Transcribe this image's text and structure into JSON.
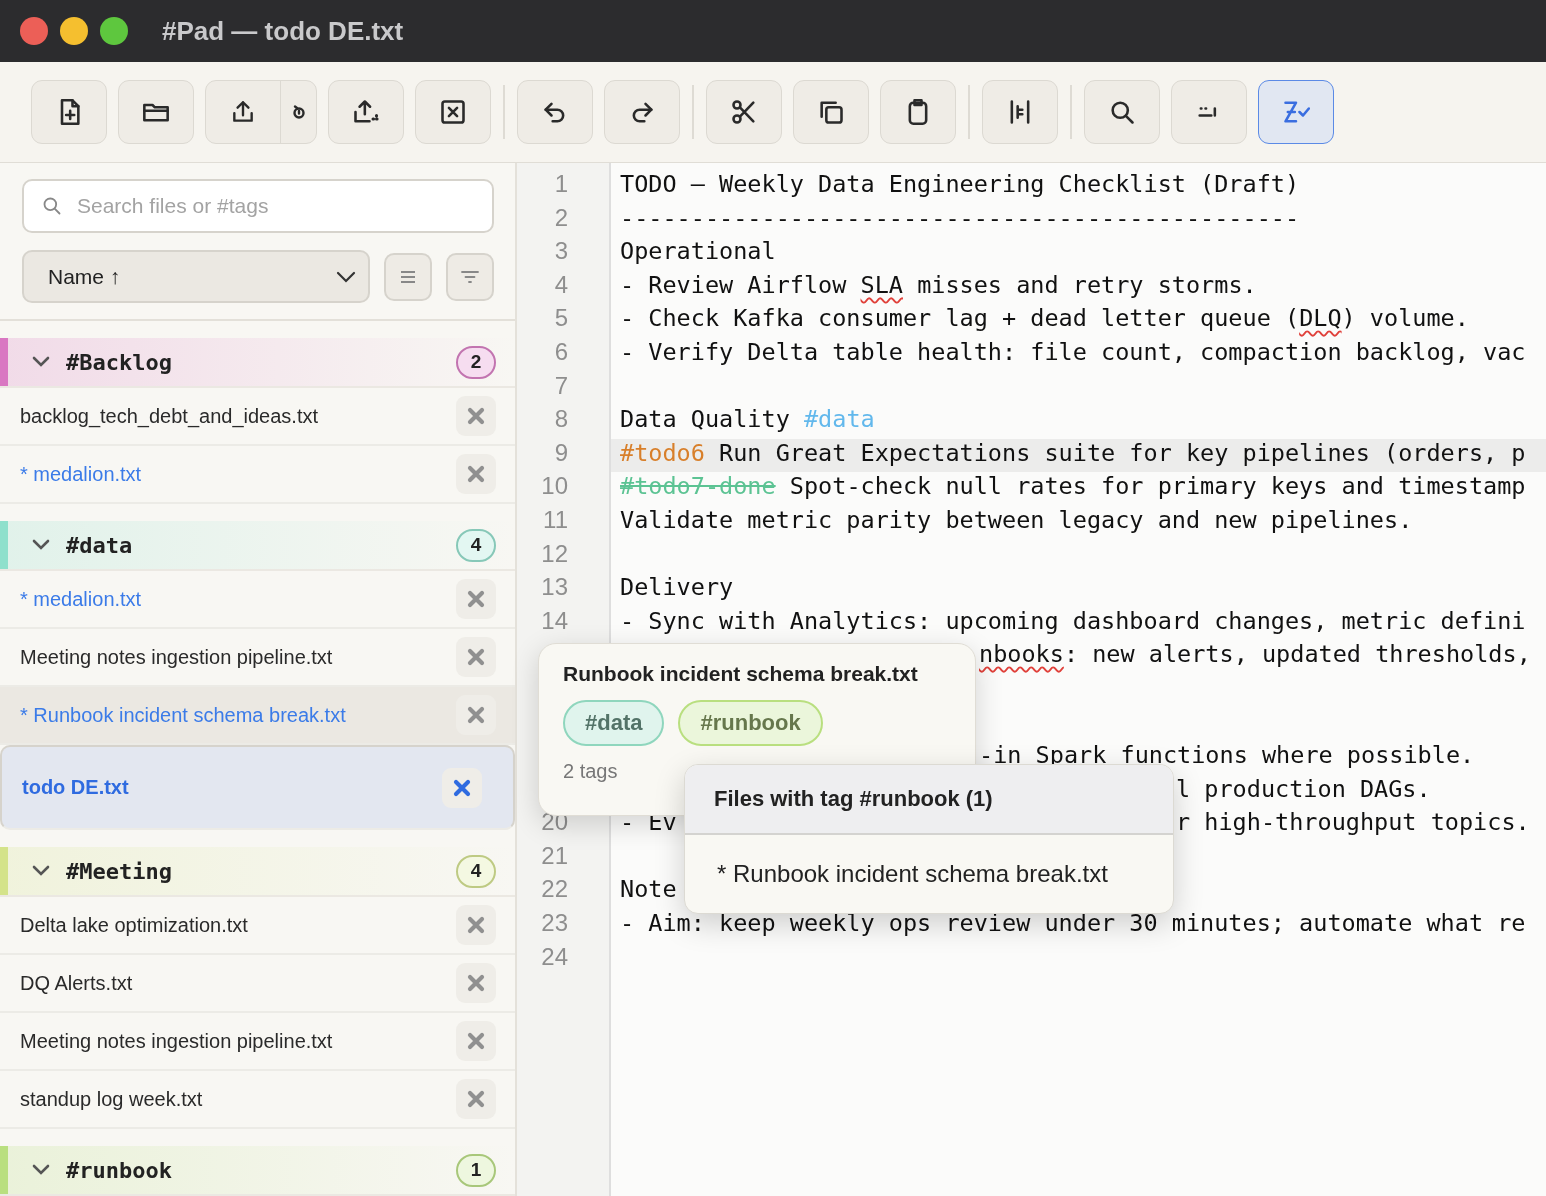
{
  "window": {
    "title": "#Pad — todo DE.txt"
  },
  "toolbar": {
    "items": [
      {
        "kind": "new-file",
        "on": false
      },
      {
        "kind": "open-folder",
        "on": false
      },
      {
        "kind": "export-split",
        "on": false
      },
      {
        "kind": "export-tray",
        "on": false
      },
      {
        "kind": "close-file",
        "on": false
      },
      {
        "kind": "separator"
      },
      {
        "kind": "undo",
        "on": false
      },
      {
        "kind": "redo",
        "on": false
      },
      {
        "kind": "separator"
      },
      {
        "kind": "cut",
        "on": false
      },
      {
        "kind": "copy",
        "on": false
      },
      {
        "kind": "paste",
        "on": false
      },
      {
        "kind": "separator"
      },
      {
        "kind": "columns",
        "on": false
      },
      {
        "kind": "separator"
      },
      {
        "kind": "search",
        "on": false
      },
      {
        "kind": "whitespace",
        "on": false
      },
      {
        "kind": "spellcheck",
        "on": true
      }
    ]
  },
  "sidebar": {
    "search": {
      "placeholder": "Search files or #tags"
    },
    "sort": {
      "value": "Name ↑"
    },
    "groups": [
      {
        "name": "#Backlog",
        "count": "2",
        "color": "#d977c2",
        "expanded": true,
        "files": [
          {
            "name": "backlog_tech_debt_and_ideas.txt",
            "modified": false,
            "selected": false,
            "hovered": false
          },
          {
            "name": "* medalion.txt",
            "modified": true,
            "selected": false,
            "hovered": false
          }
        ]
      },
      {
        "name": "#data",
        "count": "4",
        "color": "#8fe0cc",
        "expanded": true,
        "files": [
          {
            "name": "* medalion.txt",
            "modified": true,
            "selected": false,
            "hovered": false
          },
          {
            "name": "Meeting notes ingestion pipeline.txt",
            "modified": false,
            "selected": false,
            "hovered": false
          },
          {
            "name": "* Runbook incident schema break.txt",
            "modified": true,
            "selected": false,
            "hovered": true
          },
          {
            "name": "todo DE.txt",
            "modified": false,
            "selected": true,
            "hovered": false
          }
        ]
      },
      {
        "name": "#Meeting",
        "count": "4",
        "color": "#d4e38a",
        "expanded": true,
        "files": [
          {
            "name": "Delta lake optimization.txt",
            "modified": false,
            "selected": false,
            "hovered": false
          },
          {
            "name": "DQ Alerts.txt",
            "modified": false,
            "selected": false,
            "hovered": false
          },
          {
            "name": "Meeting notes ingestion pipeline.txt",
            "modified": false,
            "selected": false,
            "hovered": false
          },
          {
            "name": "standup log week.txt",
            "modified": false,
            "selected": false,
            "hovered": false
          }
        ]
      },
      {
        "name": "#runbook",
        "count": "1",
        "color": "#b9df7f",
        "expanded": true
      }
    ]
  },
  "editor": {
    "lines": [
      {
        "n": "1",
        "current": false,
        "segments": [
          {
            "kind": "plain",
            "text": "TODO — Weekly Data Engineering Checklist (Draft)"
          }
        ]
      },
      {
        "n": "2",
        "current": false,
        "segments": [
          {
            "kind": "plain",
            "text": "------------------------------------------------"
          }
        ]
      },
      {
        "n": "3",
        "current": false,
        "segments": [
          {
            "kind": "plain",
            "text": "Operational"
          }
        ]
      },
      {
        "n": "4",
        "current": false,
        "segments": [
          {
            "kind": "plain",
            "text": "- Review Airflow "
          },
          {
            "kind": "misspelled",
            "text": "SLA"
          },
          {
            "kind": "plain",
            "text": " misses and retry storms."
          }
        ]
      },
      {
        "n": "5",
        "current": false,
        "segments": [
          {
            "kind": "plain",
            "text": "- Check Kafka consumer lag + dead letter queue ("
          },
          {
            "kind": "misspelled",
            "text": "DLQ"
          },
          {
            "kind": "plain",
            "text": ") volume."
          }
        ]
      },
      {
        "n": "6",
        "current": false,
        "segments": [
          {
            "kind": "plain",
            "text": "- Verify Delta table health: file count, compaction backlog, vac"
          }
        ]
      },
      {
        "n": "7",
        "current": false
      },
      {
        "n": "8",
        "current": false,
        "segments": [
          {
            "kind": "plain",
            "text": "Data Quality "
          },
          {
            "kind": "tag",
            "text": "#data"
          }
        ]
      },
      {
        "n": "9",
        "current": true,
        "segments": [
          {
            "kind": "todo",
            "text": "#todo6"
          },
          {
            "kind": "plain",
            "text": " Run Great Expectations suite for key pipelines (orders, p"
          }
        ]
      },
      {
        "n": "10",
        "current": false,
        "segments": [
          {
            "kind": "done",
            "text": "#todo7-done"
          },
          {
            "kind": "plain",
            "text": " Spot-check null rates for primary keys and timestamp"
          }
        ]
      },
      {
        "n": "11",
        "current": false,
        "segments": [
          {
            "kind": "plain",
            "text": "Validate metric parity between legacy and new pipelines."
          }
        ]
      },
      {
        "n": "12",
        "current": false
      },
      {
        "n": "13",
        "current": false,
        "segments": [
          {
            "kind": "plain",
            "text": "Delivery"
          }
        ]
      },
      {
        "n": "14",
        "current": false,
        "segments": [
          {
            "kind": "plain",
            "text": "- Sync with Analytics: upcoming dashboard changes, metric defini"
          }
        ]
      },
      {
        "current": false,
        "segments": [
          {
            "kind": "misspelled",
            "text": "nbooks",
            "covered_before": true
          },
          {
            "kind": "plain",
            "text": ": new alerts, updated thresholds,"
          }
        ]
      },
      {
        "current": false
      },
      {
        "current": false
      },
      {
        "current": false,
        "segments": [
          {
            "kind": "plain",
            "text": "-in Spark functions where possible.",
            "covered_before": true
          }
        ]
      },
      {
        "current": false,
        "segments": [
          {
            "kind": "plain",
            "text": "l production DAGs.",
            "covered_before": true
          }
        ]
      },
      {
        "n": "20",
        "current": false,
        "segments": [
          {
            "kind": "plain",
            "text": "- Ev"
          },
          {
            "kind": "plain",
            "text": "r high-throughput topics.",
            "covered_before": true
          }
        ]
      },
      {
        "n": "21",
        "current": false
      },
      {
        "n": "22",
        "current": false,
        "segments": [
          {
            "kind": "plain",
            "text": "Note"
          }
        ]
      },
      {
        "n": "23",
        "current": false,
        "segments": [
          {
            "kind": "plain",
            "text": "- Aim: keep weekly ops review under 30 minutes; automate what re"
          }
        ]
      },
      {
        "n": "24",
        "current": false
      }
    ]
  },
  "tags_popup": {
    "title": "Runbook incident schema break.txt",
    "tags": [
      {
        "label": "#data",
        "color": "#8fd6bd"
      },
      {
        "label": "#runbook",
        "color": "#b9df7f"
      }
    ],
    "summary": "2 tags"
  },
  "files_popup": {
    "title": "Files with tag #runbook (1)",
    "files": [
      "* Runbook incident schema break.txt"
    ]
  }
}
